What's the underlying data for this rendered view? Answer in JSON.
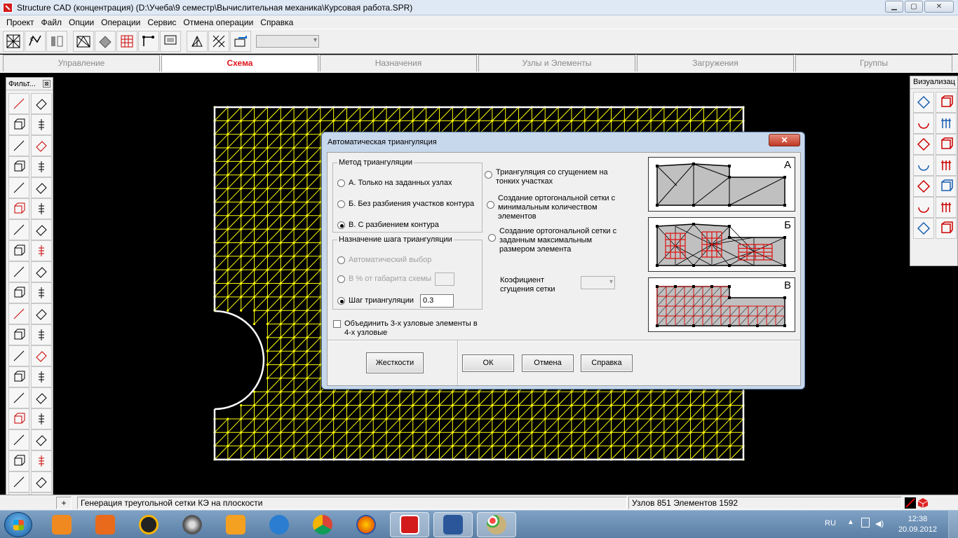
{
  "window": {
    "title": "Structure CAD (концентрация) (D:\\Учеба\\9 семестр\\Вычислительная механика\\Курсовая работа.SPR)",
    "min": "▁",
    "max": "▢",
    "close": "✕"
  },
  "menu": [
    "Проект",
    "Файл",
    "Опции",
    "Операции",
    "Сервис",
    "Отмена операции",
    "Справка"
  ],
  "tabs": [
    "Управление",
    "Схема",
    "Назначения",
    "Узлы и Элементы",
    "Загружения",
    "Группы"
  ],
  "active_tab": "Схема",
  "left_panel": {
    "title": "Фильт...",
    "close": "⊠"
  },
  "right_panel": {
    "title": "Визуализац"
  },
  "dialog": {
    "title": "Автоматическая триангуляция",
    "close": "✕",
    "method_group": "Метод триангуляции",
    "method_a": "А. Только на заданных узлах",
    "method_b": "Б. Без разбиения участков контура",
    "method_c": "В. С разбиением контура",
    "step_group": "Назначение шага триангуляции",
    "step_auto": "Автоматический выбор",
    "step_percent": "В % от габарита схемы",
    "step_value_label": "Шаг триангуляции",
    "step_value": "0.3",
    "merge_checkbox": "Объединить 3-х узловые элементы в 4-х узловые",
    "opt_thin": "Триангуляция со сгущением на тонких участках",
    "opt_ortho_min": "Создание ортогональной сетки с минимальным количеством элементов",
    "opt_ortho_max": "Создание ортогональной сетки с заданным максимальным размером элемента",
    "coef_label": "Коэфициент сгущения сетки",
    "btn_stiffness": "Жесткости",
    "btn_ok": "ОК",
    "btn_cancel": "Отмена",
    "btn_help": "Справка",
    "preview_a": "А",
    "preview_b": "Б",
    "preview_c": "В"
  },
  "status": {
    "message": "Генерация треугольной сетки КЭ на плоскости",
    "counts": "Узлов 851 Элементов 1592"
  },
  "taskbar": {
    "lang": "RU",
    "time": "12:38",
    "date": "20.09.2012"
  },
  "colors": {
    "mesh": "#ffff00",
    "boundary": "#ffffff",
    "active_tab": "#e0141e",
    "preview_fill": "#c0c0c0",
    "preview_red": "#e01010"
  }
}
